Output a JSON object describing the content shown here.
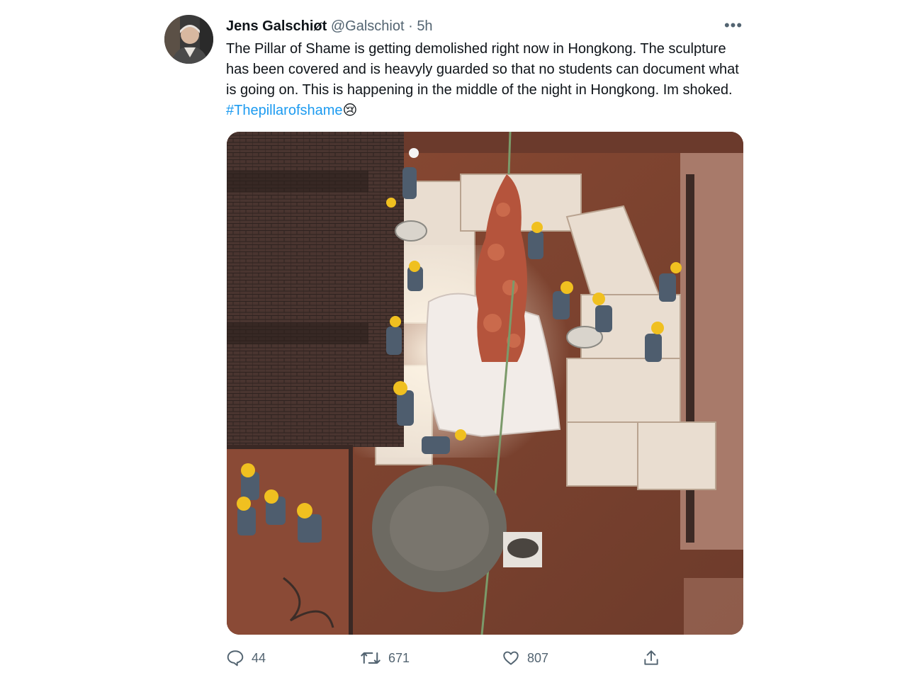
{
  "tweet": {
    "author_name": "Jens Galschiøt",
    "handle": "@Galschiot",
    "separator": "·",
    "time": "5h",
    "more_label": "•••",
    "text_parts": [
      "The Pillar of Shame is getting demolished right now in Hongkong. The sculpture has been covered and is heavyly guarded so that no students can document what is going on. This is happening in the middle of the night in Hongkong. Im shoked. "
    ],
    "hashtag": "#Thepillarofshame",
    "emoji": "😢"
  },
  "actions": {
    "reply_count": "44",
    "retweet_count": "671",
    "like_count": "807"
  },
  "colors": {
    "link": "#1d9bf0",
    "muted": "#536471",
    "text": "#0f1419"
  },
  "icons": {
    "reply": "reply-icon",
    "retweet": "retweet-icon",
    "like": "heart-icon",
    "share": "share-icon"
  }
}
